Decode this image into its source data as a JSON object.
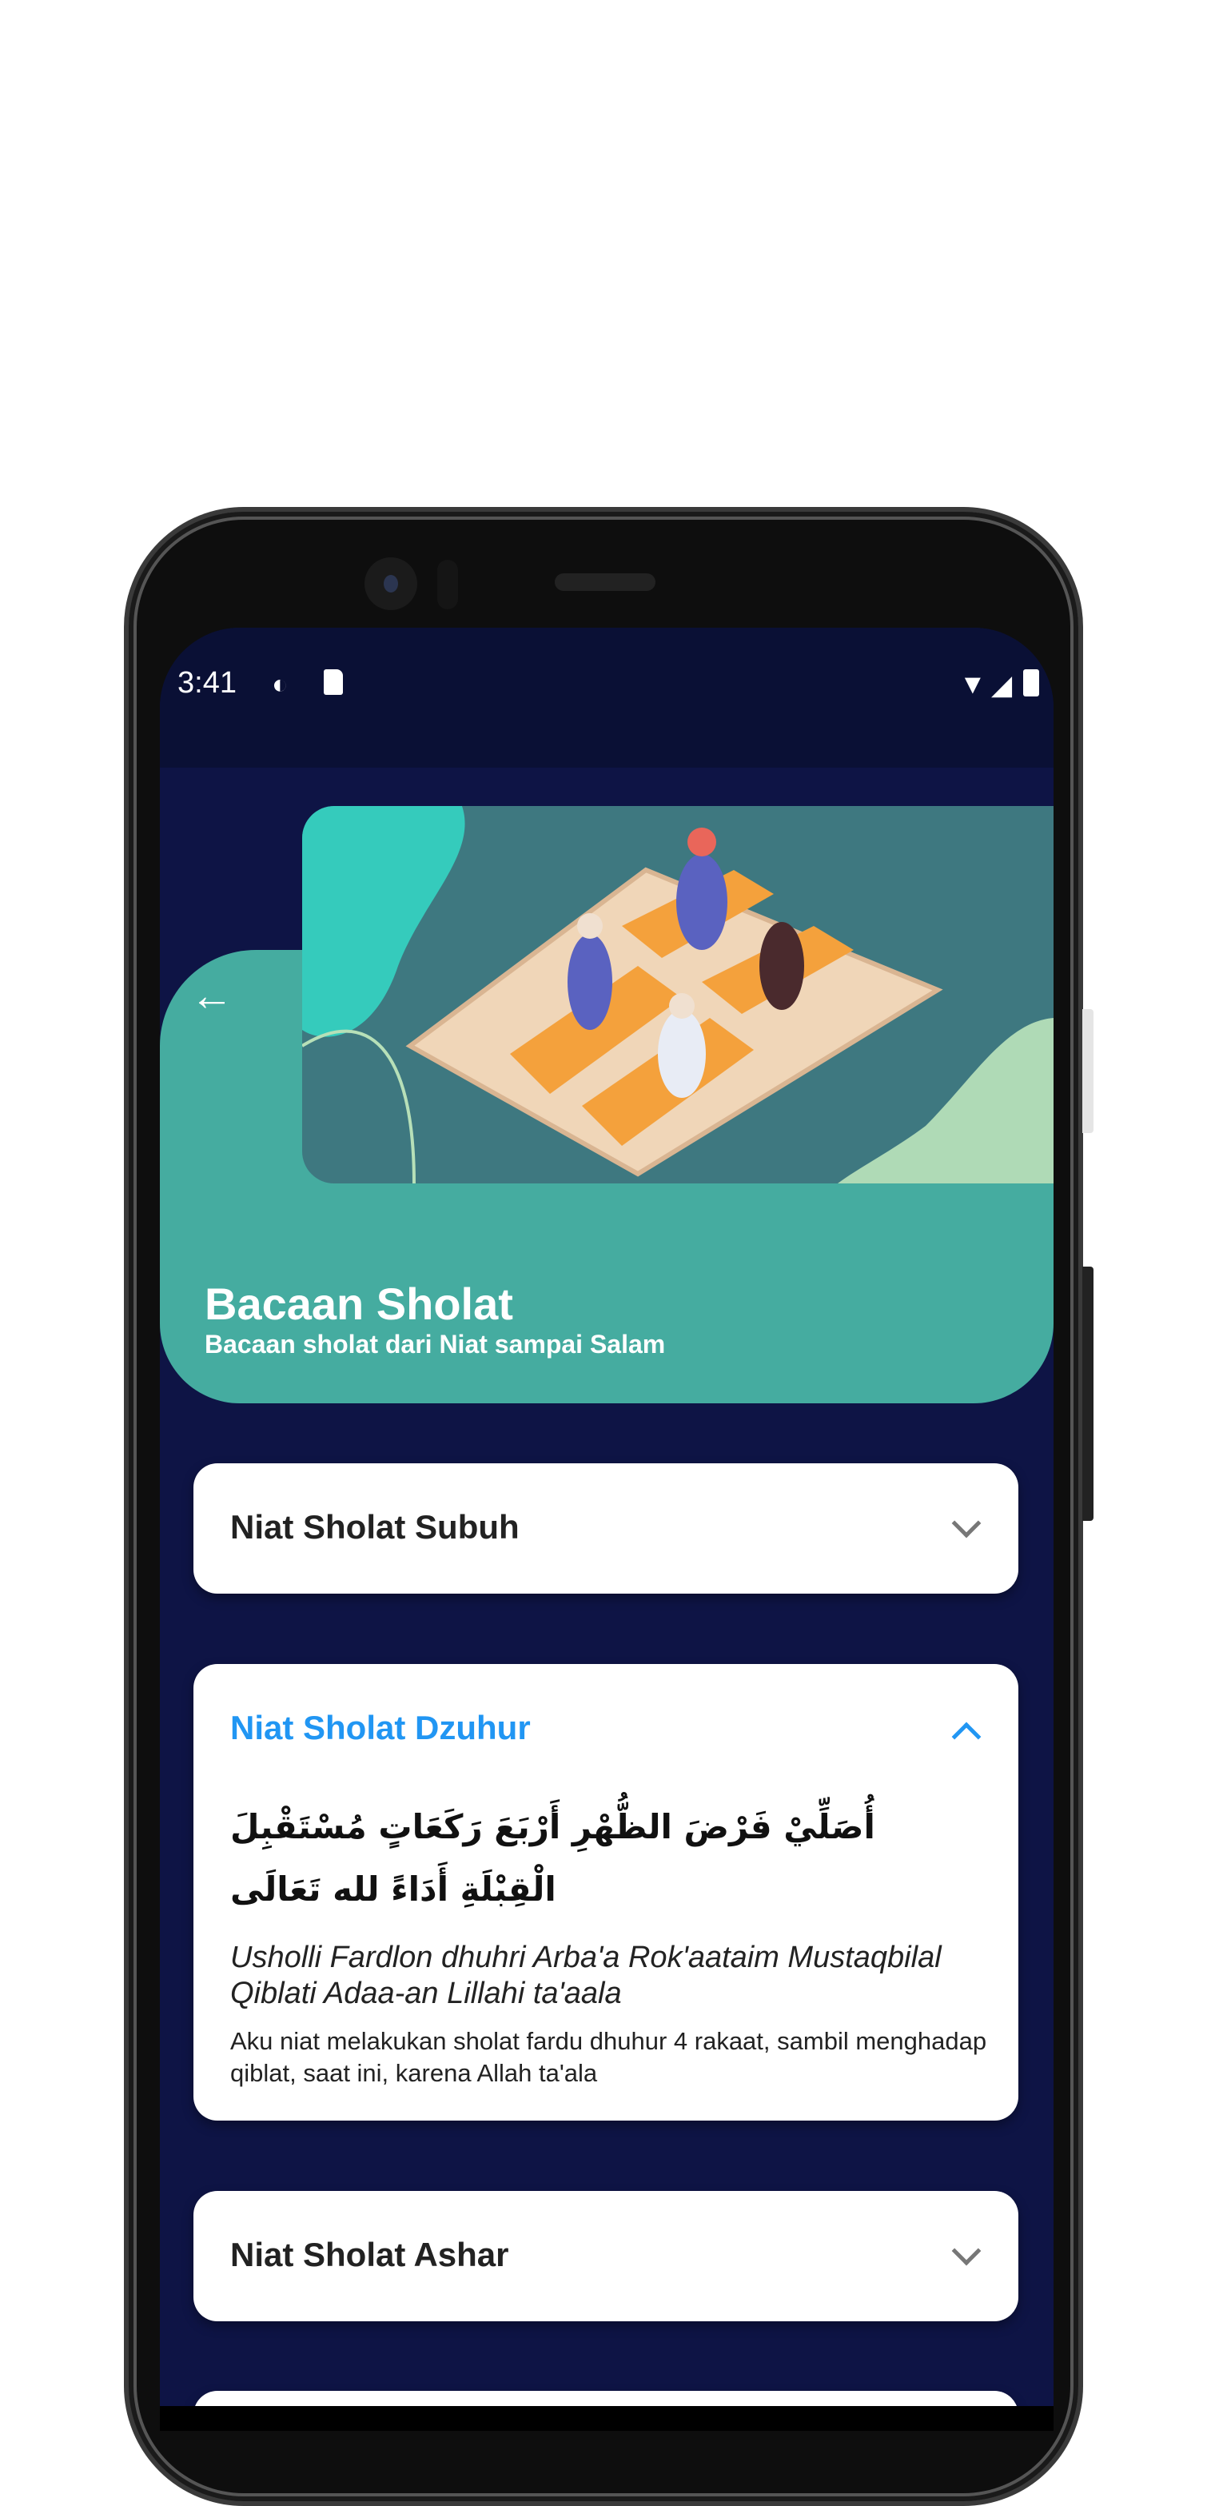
{
  "status_bar": {
    "time": "3:41",
    "icons": [
      "data-saver-icon",
      "sd-card-icon",
      "wifi-icon",
      "signal-icon",
      "battery-icon"
    ]
  },
  "header": {
    "title": "Bacaan Sholat",
    "subtitle": "Bacaan sholat dari Niat sampai Salam",
    "back_icon": "arrow-left-icon"
  },
  "colors": {
    "background": "#0e1445",
    "header": "#45aca0",
    "accent": "#2196f3",
    "card": "#ffffff"
  },
  "sections": [
    {
      "title": "Niat Sholat Subuh",
      "expanded": false
    },
    {
      "title": "Niat Sholat Dzuhur",
      "expanded": true,
      "arabic": "أُصَلِّيْ فَرْضَ الظُّهْرِ أَرْبَعَ رَكَعَاتٍ مُسْتَقْبِلَ الْقِبْلَةِ أَدَاءً لله تَعَالَى",
      "latin": "Usholli Fardlon dhuhri Arba'a Rok'aataim Mustaqbilal Qiblati Adaa-an Lillahi ta'aala",
      "translation": "Aku niat melakukan sholat fardu dhuhur 4 rakaat, sambil menghadap qiblat, saat ini, karena Allah ta'ala"
    },
    {
      "title": "Niat Sholat Ashar",
      "expanded": false
    }
  ]
}
